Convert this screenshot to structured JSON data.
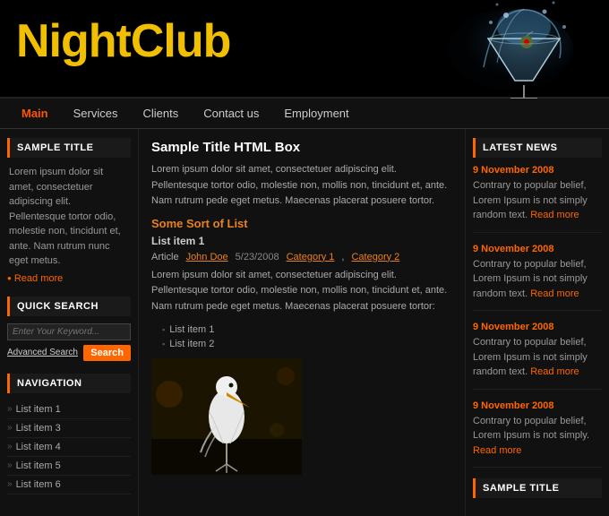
{
  "header": {
    "title_part1": "Night",
    "title_part2": "Club"
  },
  "nav": {
    "items": [
      {
        "label": "Main",
        "active": true
      },
      {
        "label": "Services",
        "active": false
      },
      {
        "label": "Clients",
        "active": false
      },
      {
        "label": "Contact us",
        "active": false
      },
      {
        "label": "Employment",
        "active": false
      }
    ]
  },
  "left_sidebar": {
    "sample_title": {
      "heading": "SAMPLE TITLE",
      "text": "Lorem ipsum dolor sit amet, consectetuer adipiscing elit. Pellentesque tortor odio, molestie non, tincidunt et, ante. Nam rutrum nunc eget metus.",
      "read_more": "Read more"
    },
    "quick_search": {
      "heading": "QUICK SEARCH",
      "placeholder": "Enter Your Keyword...",
      "advanced_link": "Advanced Search",
      "search_btn": "Search"
    },
    "navigation": {
      "heading": "NAVIGATION",
      "items": [
        "List item 1",
        "List item 3",
        "List item 4",
        "List item 5",
        "List item 6"
      ]
    }
  },
  "center": {
    "box_title": "Sample Title HTML Box",
    "body_text": "Lorem ipsum dolor sit amet, consectetuer adipiscing elit. Pellentesque tortor odio, molestie non, mollis non, tincidunt et, ante. Nam rutrum pede eget metus. Maecenas placerat posuere tortor.",
    "list_title": "Some Sort of List",
    "list_item_title": "List item 1",
    "article": {
      "label": "Article",
      "author": "John Doe",
      "date": "5/23/2008",
      "category1": "Category 1",
      "category2": "Category 2"
    },
    "article_body": "Lorem ipsum dolor sit amet, consectetuer adipiscing elit. Pellentesque tortor odio, molestie non, mollis non, tincidunt et, ante. Nam rutrum pede eget metus. Maecenas placerat posuere tortor:",
    "sub_items": [
      "List item 1",
      "List item 2"
    ]
  },
  "right_sidebar": {
    "latest_news": {
      "heading": "LATEST NEWS",
      "items": [
        {
          "date": "9 November 2008",
          "text": "Contrary to popular belief, Lorem Ipsum is not simply random text.",
          "read_more": "Read more"
        },
        {
          "date": "9 November 2008",
          "text": "Contrary to popular belief, Lorem Ipsum is not simply random text.",
          "read_more": "Read more"
        },
        {
          "date": "9 November 2008",
          "text": "Contrary to popular belief, Lorem Ipsum is not simply random text.",
          "read_more": "Read more"
        },
        {
          "date": "9 November 2008",
          "text": "Contrary to popular belief, Lorem Ipsum is not simply.",
          "read_more": "Read more"
        }
      ]
    },
    "sample_title": {
      "heading": "SAMPLE TITLE"
    }
  }
}
